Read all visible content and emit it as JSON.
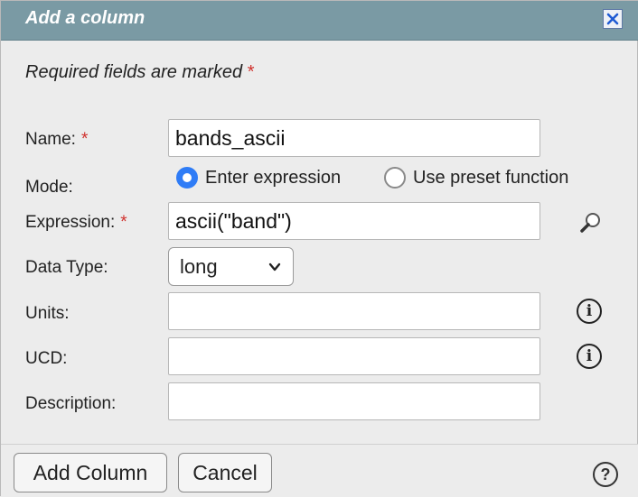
{
  "dialog": {
    "title": "Add a column",
    "close_icon": "close-icon"
  },
  "required_note": {
    "text": "Required fields are marked",
    "marker": "*"
  },
  "fields": {
    "name": {
      "label": "Name:",
      "required": "*",
      "value": "bands_ascii"
    },
    "mode": {
      "label": "Mode:",
      "options": [
        {
          "label": "Enter expression",
          "selected": true
        },
        {
          "label": "Use preset function",
          "selected": false
        }
      ]
    },
    "expression": {
      "label": "Expression:",
      "required": "*",
      "value": "ascii(\"band\")",
      "icon": "magnifier-icon"
    },
    "data_type": {
      "label": "Data Type:",
      "value": "long",
      "icon": "chevron-down-icon"
    },
    "units": {
      "label": "Units:",
      "value": "",
      "icon": "info-icon"
    },
    "ucd": {
      "label": "UCD:",
      "value": "",
      "icon": "info-icon"
    },
    "description": {
      "label": "Description:",
      "value": ""
    }
  },
  "footer": {
    "add_label": "Add Column",
    "cancel_label": "Cancel",
    "help_icon": "help-icon"
  },
  "colors": {
    "titlebar": "#7a9aa4",
    "required_star": "#d0312d",
    "radio_selected": "#2f7cf6"
  }
}
